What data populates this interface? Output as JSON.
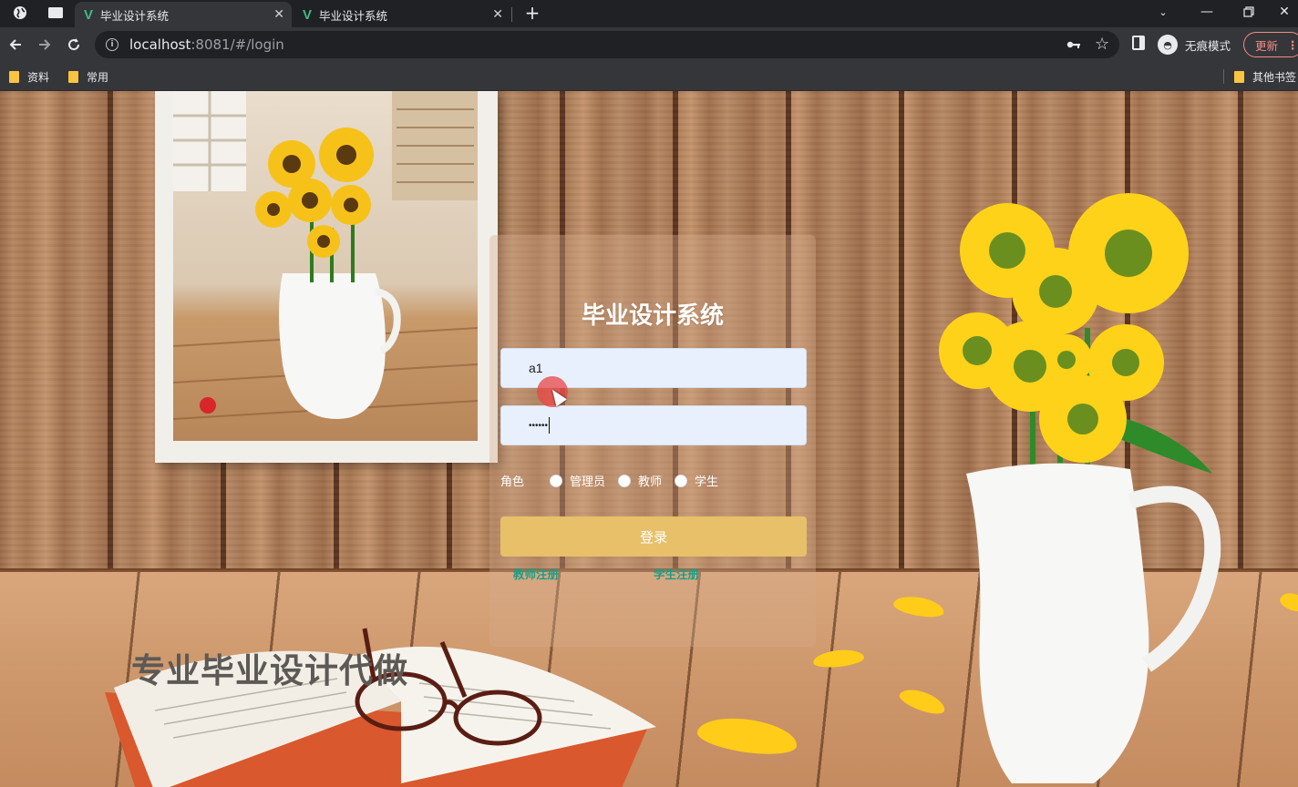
{
  "browser": {
    "tabs": [
      {
        "title": "毕业设计系统",
        "active": true
      },
      {
        "title": "毕业设计系统",
        "active": false
      }
    ],
    "url_host": "localhost",
    "url_rest": ":8081/#/login",
    "profile_label": "无痕模式",
    "update_label": "更新",
    "bookmarks": [
      "资料",
      "常用"
    ],
    "other_bookmarks": "其他书签",
    "colors": {
      "vue_green": "#41b883",
      "update_red": "#f28b82"
    }
  },
  "login": {
    "title": "毕业设计系统",
    "username_value": "a1",
    "password_mask": "••••••",
    "role_label": "角色",
    "roles": [
      "管理员",
      "教师",
      "学生"
    ],
    "submit_label": "登录",
    "links": [
      "教师注册",
      "学生注册"
    ],
    "colors": {
      "button": "#e7c069",
      "link": "#1a9e86"
    }
  },
  "banner": {
    "slogan": "专业毕业设计代做"
  },
  "icons": [
    "globe-icon",
    "page-icon",
    "vue-logo-icon",
    "close-icon",
    "plus-icon",
    "chevron-down-icon",
    "minimize-icon",
    "restore-icon",
    "back-icon",
    "forward-icon",
    "reload-icon",
    "info-icon",
    "key-icon",
    "star-icon",
    "side-panel-icon",
    "incognito-icon",
    "folder-icon"
  ]
}
